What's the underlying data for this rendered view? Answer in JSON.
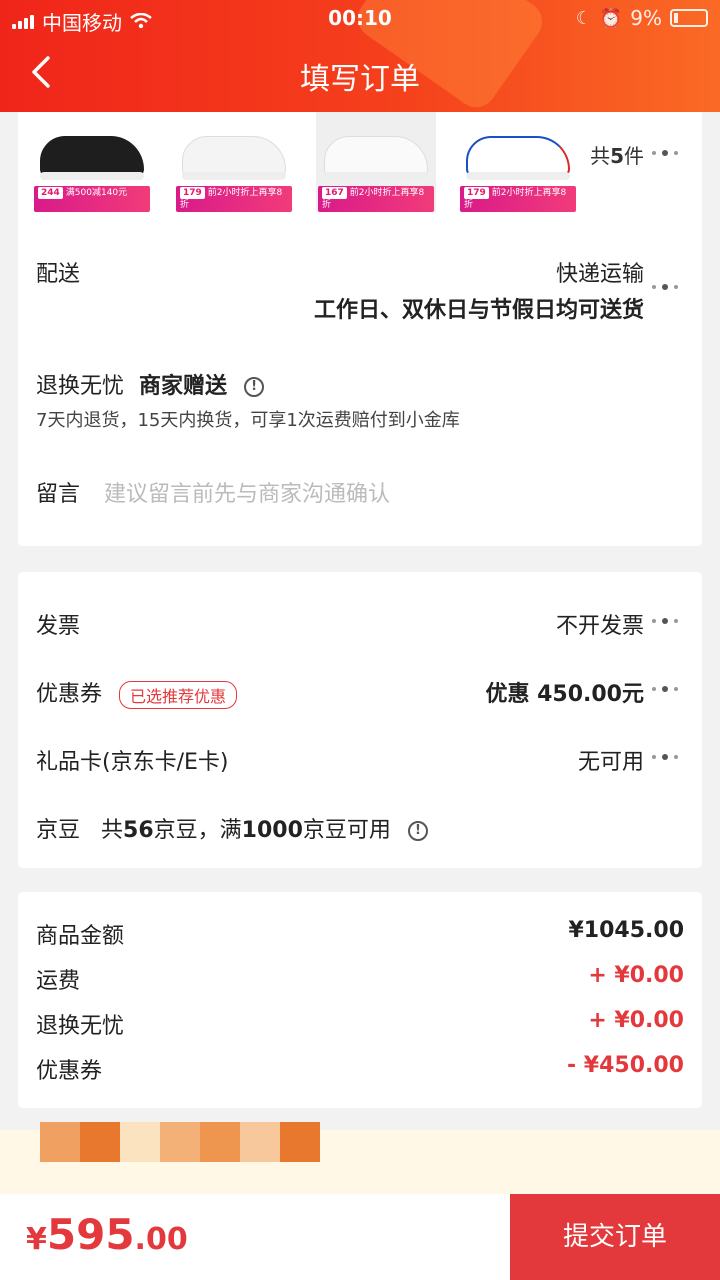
{
  "status": {
    "carrier": "中国移动",
    "time": "00:10",
    "battery": "9%"
  },
  "header": {
    "title": "填写订单"
  },
  "products": {
    "count_prefix": "共",
    "count": "5",
    "count_suffix": "件",
    "items": [
      {
        "color": "#1e1e1e",
        "accent": "#ffffff",
        "price": "244",
        "tag": "满500减140元"
      },
      {
        "color": "#f4f4f4",
        "accent": "#dddddd",
        "price": "179",
        "tag": "前2小时折上再享8折"
      },
      {
        "color": "#f7f7f7",
        "accent": "#e07a9a",
        "price": "167",
        "tag": "前2小时折上再享8折"
      },
      {
        "color": "#ffffff",
        "accent": "#1c4fc7",
        "price": "179",
        "tag": "前2小时折上再享8折"
      }
    ]
  },
  "delivery": {
    "label": "配送",
    "method": "快递运输",
    "schedule": "工作日、双休日与节假日均可送货"
  },
  "returns": {
    "label": "退换无忧",
    "provider": "商家赠送",
    "desc": "7天内退货，15天内换货，可享1次运费赔付到小金库"
  },
  "note": {
    "label": "留言",
    "placeholder": "建议留言前先与商家沟通确认"
  },
  "invoice": {
    "label": "发票",
    "value": "不开发票"
  },
  "coupon": {
    "label": "优惠券",
    "badge": "已选推荐优惠",
    "value": "优惠 450.00元"
  },
  "giftcard": {
    "label": "礼品卡(京东卡/E卡)",
    "value": "无可用"
  },
  "beans": {
    "label": "京豆",
    "text_a": "共",
    "count": "56",
    "text_b": "京豆，满",
    "threshold": "1000",
    "text_c": "京豆可用"
  },
  "summary": [
    {
      "label": "商品金额",
      "value": "¥1045.00",
      "color": "#222222"
    },
    {
      "label": "运费",
      "value": "+ ¥0.00",
      "color": "#e4393c"
    },
    {
      "label": "退换无忧",
      "value": "+ ¥0.00",
      "color": "#e4393c"
    },
    {
      "label": "优惠券",
      "value": "- ¥450.00",
      "color": "#e4393c"
    }
  ],
  "footer": {
    "currency": "¥",
    "total_int": "595",
    "total_dec": ".00",
    "submit": "提交订单"
  },
  "colors": {
    "brand": "#f0251a",
    "accent_red": "#e4393c"
  }
}
